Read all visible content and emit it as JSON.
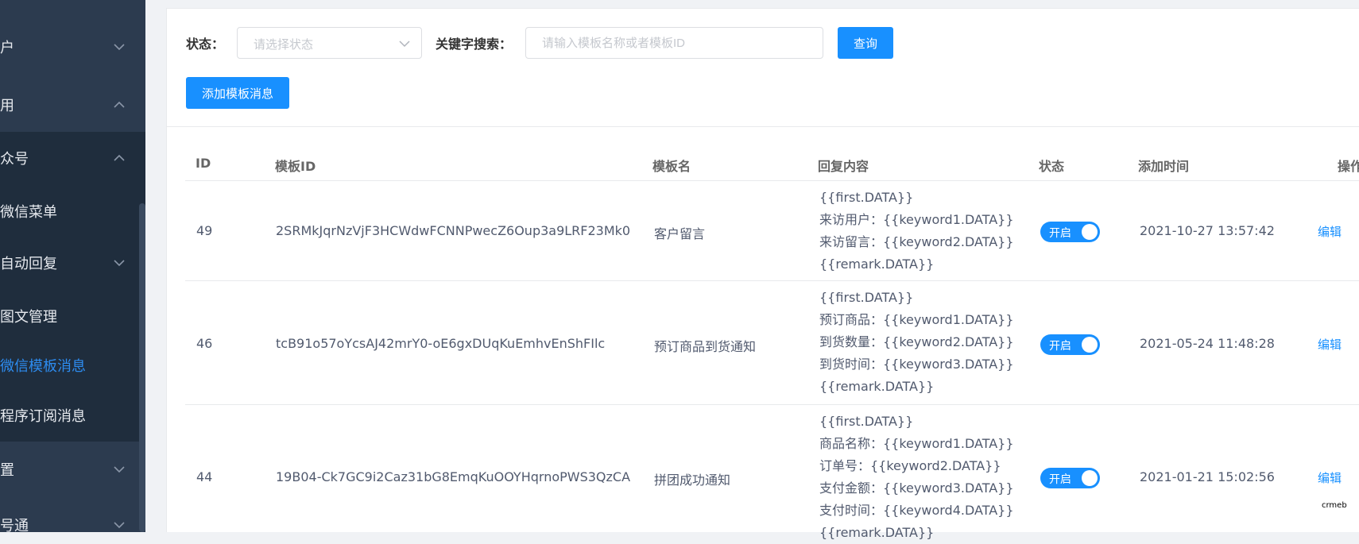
{
  "sidebar": {
    "items": [
      {
        "label": "户"
      },
      {
        "label": "用"
      },
      {
        "label": "众号"
      }
    ],
    "submenu": [
      {
        "label": "微信菜单"
      },
      {
        "label": "自动回复"
      },
      {
        "label": "图文管理"
      },
      {
        "label": "微信模板消息"
      },
      {
        "label": "程序订阅消息"
      }
    ],
    "bottom_items": [
      {
        "label": "置"
      },
      {
        "label": "号通"
      }
    ],
    "active_color": "#2d8cf0"
  },
  "filters": {
    "status_label": "状态：",
    "status_placeholder": "请选择状态",
    "keyword_label": "关键字搜索：",
    "keyword_placeholder": "请输入模板名称或者模板ID",
    "query_button": "查询",
    "add_button": "添加模板消息"
  },
  "table": {
    "headers": [
      "ID",
      "模板ID",
      "模板名",
      "回复内容",
      "状态",
      "添加时间",
      "操作"
    ],
    "rows": [
      {
        "id": "49",
        "template_id": "2SRMkJqrNzVjF3HCWdwFCNNPwecZ6Oup3a9LRF23Mk0",
        "name": "客户留言",
        "reply": [
          "{{first.DATA}}",
          "来访用户：{{keyword1.DATA}}",
          "来访留言：{{keyword2.DATA}}",
          "{{remark.DATA}}"
        ],
        "status": "开启",
        "time": "2021-10-27 13:57:42",
        "edit": "编辑"
      },
      {
        "id": "46",
        "template_id": "tcB91o57oYcsAJ42mrY0-oE6gxDUqKuEmhvEnShFIlc",
        "name": "预订商品到货通知",
        "reply": [
          "{{first.DATA}}",
          "预订商品：{{keyword1.DATA}}",
          "到货数量：{{keyword2.DATA}}",
          "到货时间：{{keyword3.DATA}}",
          "{{remark.DATA}}"
        ],
        "status": "开启",
        "time": "2021-05-24 11:48:28",
        "edit": "编辑"
      },
      {
        "id": "44",
        "template_id": "19B04-Ck7GC9i2Caz31bG8EmqKuOOYHqrnoPWS3QzCA",
        "name": "拼团成功通知",
        "reply": [
          "{{first.DATA}}",
          "商品名称：{{keyword1.DATA}}",
          "订单号：{{keyword2.DATA}}",
          "支付金额：{{keyword3.DATA}}",
          "支付时间：{{keyword4.DATA}}",
          "{{remark.DATA}}"
        ],
        "status": "开启",
        "time": "2021-01-21 15:02:56",
        "edit": "编辑"
      }
    ]
  },
  "colors": {
    "primary": "#1890ff",
    "sidebar_bg": "#2c3b4f",
    "sidebar_dark": "#1f2d3d"
  },
  "watermark": "crmeb"
}
